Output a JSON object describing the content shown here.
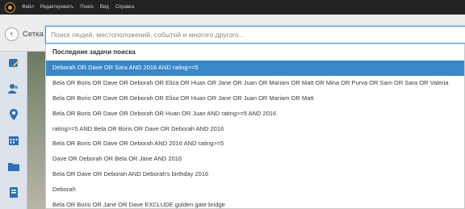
{
  "menubar": {
    "items": [
      "Файл",
      "Редактировать",
      "Поиск",
      "Вид",
      "Справка"
    ]
  },
  "toolbar": {
    "crumb": "Сетка",
    "search_placeholder": "Поиск людей, местоположений, событий и многого другого..."
  },
  "dropdown": {
    "header": "Последние задачи поиска",
    "items": [
      "Deborah OR Dave OR Sara AND 2016 AND rating>=5",
      "Bela OR Boris OR Dave OR Deborah OR Eliza OR Huan OR Jane OR Juan OR Mariam OR Matt OR Mina OR Purva OR Sam OR Sara OR Valeria",
      "Bela OR Boris OR Dave OR Deborah OR Eliza OR Huan OR Jane OR Juan OR Mariam OR Matt",
      "Bela OR Boris OR Dave OR Deborah OR Huan OR Juan AND rating>=5 AND 2016",
      "rating>=5 AND Bela OR Boris OR Dave OR Deborah AND 2016",
      "Bela OR Boris OR Dave OR Deborah AND 2016 AND rating>=5",
      "Dave OR Deborah OR Bela OR Jane AND 2016",
      "Bela OR Dave OR Deborah AND Deborah's birthday 2016",
      "Deborah",
      "Bela OR Boris OR Jane OR Dave EXCLUDE golden gate bridge"
    ],
    "selected_index": 0
  },
  "colors": {
    "selection": "#3a87c8",
    "focus_border": "#4c9ad8",
    "menubar_bg": "#222222"
  }
}
